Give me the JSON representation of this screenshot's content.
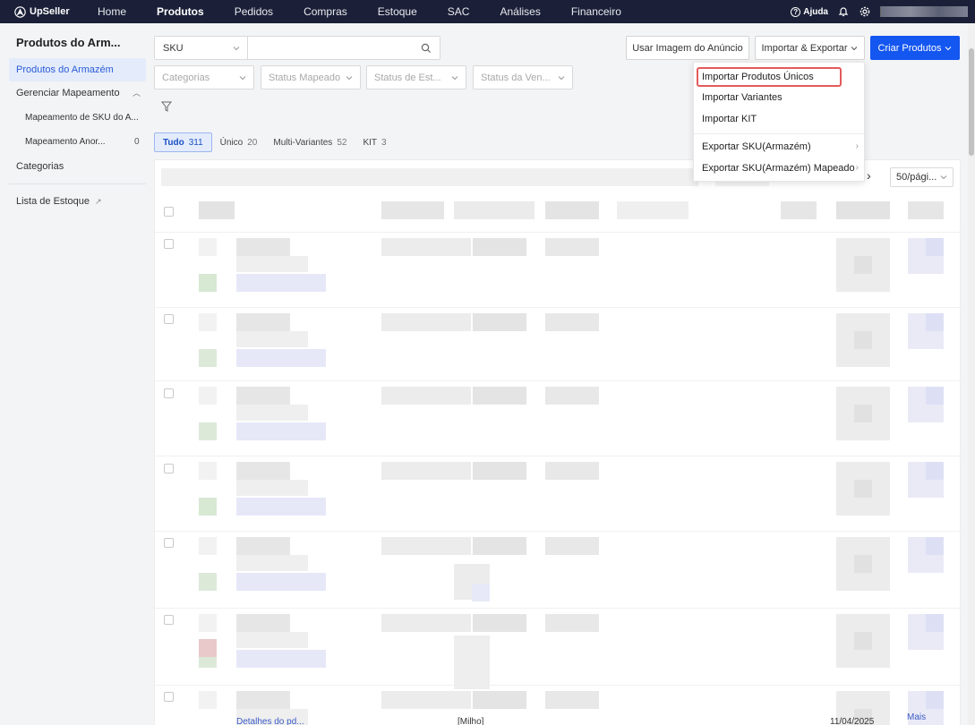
{
  "app": {
    "logo": "UpSeller"
  },
  "nav": {
    "items": [
      "Home",
      "Produtos",
      "Pedidos",
      "Compras",
      "Estoque",
      "SAC",
      "Análises",
      "Financeiro"
    ],
    "help": "Ajuda"
  },
  "sidebar": {
    "title": "Produtos do Arm...",
    "items": [
      {
        "label": "Produtos do Armazém"
      },
      {
        "label": "Gerenciar Mapeamento"
      },
      {
        "label": "Mapeamento de SKU do A..."
      },
      {
        "label": "Mapeamento Anor...",
        "count": "0"
      },
      {
        "label": "Categorias"
      },
      {
        "label": "Lista de Estoque"
      }
    ]
  },
  "toolbar": {
    "search_type": "SKU",
    "search_placeholder": "",
    "btn_image": "Usar Imagem do Anúncio",
    "btn_import_export": "Importar & Exportar",
    "btn_create": "Criar Produtos"
  },
  "filters": {
    "categories": "Categorias",
    "status_mapped": "Status Mapeado",
    "status_stock": "Status de Est...",
    "status_sales": "Status da Ven..."
  },
  "tabs": [
    {
      "label": "Tudo",
      "count": "311"
    },
    {
      "label": "Único",
      "count": "20"
    },
    {
      "label": "Multi-Variantes",
      "count": "52"
    },
    {
      "label": "KIT",
      "count": "3"
    }
  ],
  "pager": {
    "per_page": "50/pági..."
  },
  "dropdown": {
    "items": [
      "Importar Produtos Únicos",
      "Importar Variantes",
      "Importar KIT",
      "Exportar SKU(Armazém)",
      "Exportar SKU(Armazém) Mapeado"
    ]
  },
  "cut_row": {
    "col1": "Detalhes do pd...",
    "col2": "[Milho]",
    "date": "11/04/2025",
    "more": "Mais"
  },
  "colors": {
    "nav_bg": "#1b2038",
    "primary": "#1456f0",
    "highlight_outline": "#e35a5a",
    "active_tab_bg": "#e4ecfb"
  }
}
